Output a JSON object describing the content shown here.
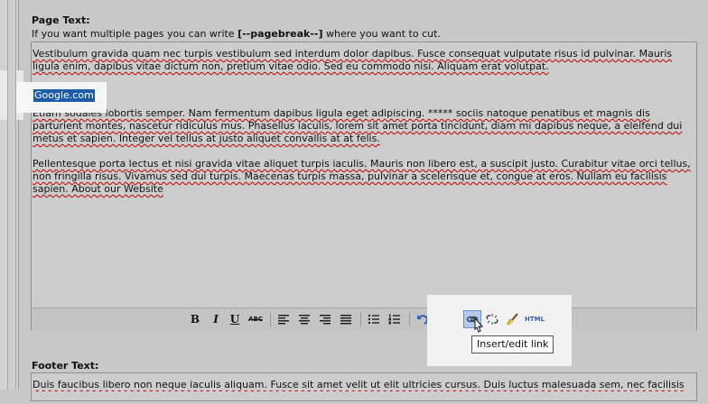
{
  "page_text": {
    "title": "Page Text:",
    "hint_before": "If you want multiple pages you can write ",
    "hint_code": "[--pagebreak--]",
    "hint_after": " where you want to cut.",
    "paragraph1": "Vestibulum gravida quam nec turpis vestibulum sed interdum dolor dapibus. Fusce consequat vulputate risus id pulvinar. Mauris ligula enim, dapibus vitae dictum non, pretium vitae odio. Sed eu commodo nisi. Aliquam erat volutpat.",
    "selected_link": "Google.com",
    "paragraph2": "Etiam sodales lobortis semper. Nam fermentum dapibus ligula eget adipiscing. ***** sociis natoque penatibus et magnis dis parturient montes, nascetur ridiculus mus. Phasellus iaculis, lorem sit amet porta tincidunt, diam mi dapibus neque, a eleifend dui metus et sapien. Integer vel tellus at justo aliquet convallis at at felis.",
    "paragraph3": "Pellentesque porta lectus et nisi gravida vitae aliquet turpis iaculis. Mauris non libero est, a suscipit justo. Curabitur vitae orci tellus, non fringilla risus. Vivamus sed dui turpis. Maecenas turpis massa, pulvinar a scelerisque et, congue at eros. Nullam eu facilisis sapien. About our Website"
  },
  "toolbar": {
    "bold": "B",
    "italic": "I",
    "underline": "U",
    "strike": "ABC",
    "html": "HTML"
  },
  "tooltip": "Insert/edit link",
  "footer_text": {
    "title": "Footer Text:",
    "content": "Duis faucibus libero non neque iaculis aliquam. Fusce sit amet velit ut elit ultricies cursus. Duis luctus malesuada sem, nec facilisis"
  },
  "colors": {
    "selection": "#1e5ba8",
    "spellcheck": "#c00000",
    "link_icon_active": "#2d6fd1"
  }
}
